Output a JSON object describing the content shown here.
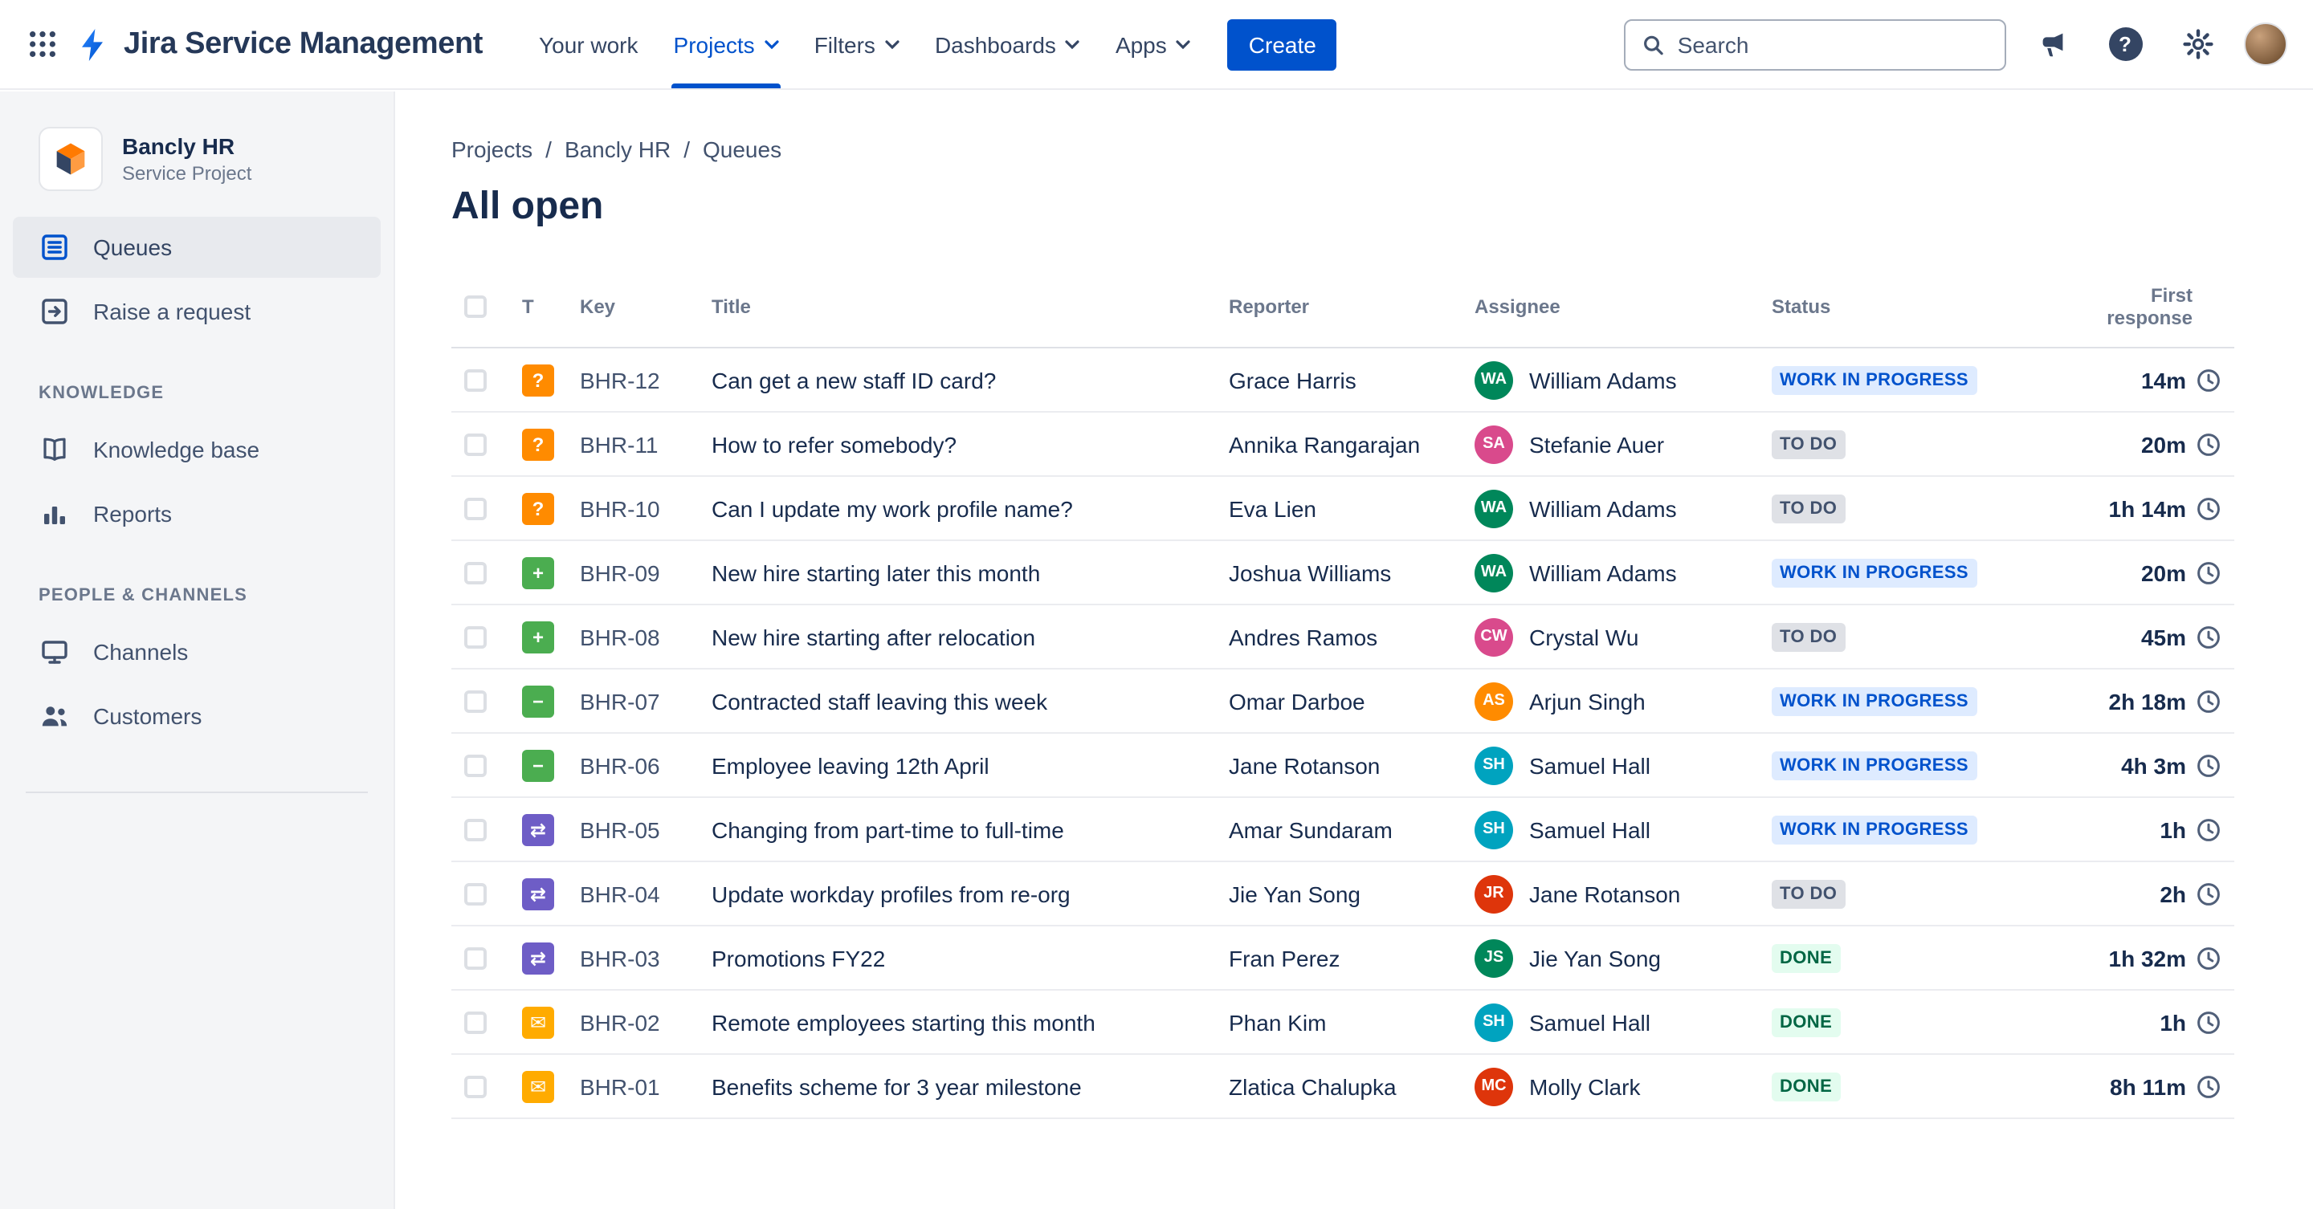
{
  "topbar": {
    "app_name": "Jira Service Management",
    "nav": [
      {
        "label": "Your work",
        "dropdown": false,
        "active": false
      },
      {
        "label": "Projects",
        "dropdown": true,
        "active": true
      },
      {
        "label": "Filters",
        "dropdown": true,
        "active": false
      },
      {
        "label": "Dashboards",
        "dropdown": true,
        "active": false
      },
      {
        "label": "Apps",
        "dropdown": true,
        "active": false
      }
    ],
    "create_label": "Create",
    "search_placeholder": "Search"
  },
  "icons": {
    "help_glyph": "?"
  },
  "sidebar": {
    "project_name": "Bancly HR",
    "project_type": "Service Project",
    "items": [
      {
        "label": "Queues",
        "selected": true
      },
      {
        "label": "Raise a request",
        "selected": false
      }
    ],
    "sections": [
      {
        "header": "KNOWLEDGE",
        "items": [
          {
            "label": "Knowledge base"
          },
          {
            "label": "Reports"
          }
        ]
      },
      {
        "header": "PEOPLE & CHANNELS",
        "items": [
          {
            "label": "Channels"
          },
          {
            "label": "Customers"
          }
        ]
      }
    ]
  },
  "breadcrumb": {
    "items": [
      "Projects",
      "Bancly HR",
      "Queues"
    ],
    "separator": "/"
  },
  "page": {
    "title": "All open"
  },
  "table": {
    "columns": [
      "T",
      "Key",
      "Title",
      "Reporter",
      "Assignee",
      "Status",
      "First response"
    ],
    "rows": [
      {
        "key": "BHR-12",
        "type": "question",
        "title": "Can get a new staff ID card?",
        "reporter": "Grace Harris",
        "assignee": "William Adams",
        "status": "WORK IN PROGRESS",
        "status_type": "inprogress",
        "first_response": "14m"
      },
      {
        "key": "BHR-11",
        "type": "question",
        "title": "How to refer somebody?",
        "reporter": "Annika Rangarajan",
        "assignee": "Stefanie Auer",
        "status": "TO DO",
        "status_type": "todo",
        "first_response": "20m"
      },
      {
        "key": "BHR-10",
        "type": "question",
        "title": "Can I update my work profile name?",
        "reporter": "Eva Lien",
        "assignee": "William Adams",
        "status": "TO DO",
        "status_type": "todo",
        "first_response": "1h 14m"
      },
      {
        "key": "BHR-09",
        "type": "new-starter",
        "title": "New hire starting later this month",
        "reporter": "Joshua Williams",
        "assignee": "William Adams",
        "status": "WORK IN PROGRESS",
        "status_type": "inprogress",
        "first_response": "20m"
      },
      {
        "key": "BHR-08",
        "type": "new-starter",
        "title": "New hire starting after relocation",
        "reporter": "Andres Ramos",
        "assignee": "Crystal Wu",
        "status": "TO DO",
        "status_type": "todo",
        "first_response": "45m"
      },
      {
        "key": "BHR-07",
        "type": "leaver",
        "title": "Contracted staff leaving this week",
        "reporter": "Omar Darboe",
        "assignee": "Arjun Singh",
        "status": "WORK IN PROGRESS",
        "status_type": "inprogress",
        "first_response": "2h 18m"
      },
      {
        "key": "BHR-06",
        "type": "leaver",
        "title": "Employee leaving 12th April",
        "reporter": "Jane Rotanson",
        "assignee": "Samuel Hall",
        "status": "WORK IN PROGRESS",
        "status_type": "inprogress",
        "first_response": "4h 3m"
      },
      {
        "key": "BHR-05",
        "type": "change",
        "title": "Changing from part-time to full-time",
        "reporter": "Amar Sundaram",
        "assignee": "Samuel Hall",
        "status": "WORK IN PROGRESS",
        "status_type": "inprogress",
        "first_response": "1h"
      },
      {
        "key": "BHR-04",
        "type": "change",
        "title": "Update workday profiles from re-org",
        "reporter": "Jie Yan Song",
        "assignee": "Jane Rotanson",
        "status": "TO DO",
        "status_type": "todo",
        "first_response": "2h"
      },
      {
        "key": "BHR-03",
        "type": "change",
        "title": "Promotions FY22",
        "reporter": "Fran Perez",
        "assignee": "Jie Yan Song",
        "status": "DONE",
        "status_type": "done",
        "first_response": "1h 32m"
      },
      {
        "key": "BHR-02",
        "type": "email",
        "title": "Remote employees starting this month",
        "reporter": "Phan Kim",
        "assignee": "Samuel Hall",
        "status": "DONE",
        "status_type": "done",
        "first_response": "1h"
      },
      {
        "key": "BHR-01",
        "type": "email",
        "title": "Benefits scheme for 3 year milestone",
        "reporter": "Zlatica Chalupka",
        "assignee": "Molly Clark",
        "status": "DONE",
        "status_type": "done",
        "first_response": "8h 11m"
      }
    ]
  },
  "type_styles": {
    "question": {
      "color": "#FF8B00",
      "glyph": "?"
    },
    "new-starter": {
      "color": "#4BAD50",
      "glyph": "+"
    },
    "leaver": {
      "color": "#4BAD50",
      "glyph": "−"
    },
    "change": {
      "color": "#6E5DC6",
      "glyph": "⇄"
    },
    "email": {
      "color": "#FFAB00",
      "glyph": "✉"
    }
  },
  "status_styles": {
    "inprogress": {
      "bg": "#DEEBFF",
      "fg": "#0052CC"
    },
    "todo": {
      "bg": "#DFE1E6",
      "fg": "#42526E"
    },
    "done": {
      "bg": "#E3FCEF",
      "fg": "#006644"
    }
  },
  "colors": {
    "accent": "#0052CC",
    "topbar_bg": "#FFFFFF",
    "sidebar_bg": "#F4F5F7",
    "avatar_palette": [
      "#00875A",
      "#DE350B",
      "#5243AA",
      "#0052CC",
      "#FF8B00",
      "#00A3BF",
      "#6554C0",
      "#D94A8C"
    ]
  }
}
